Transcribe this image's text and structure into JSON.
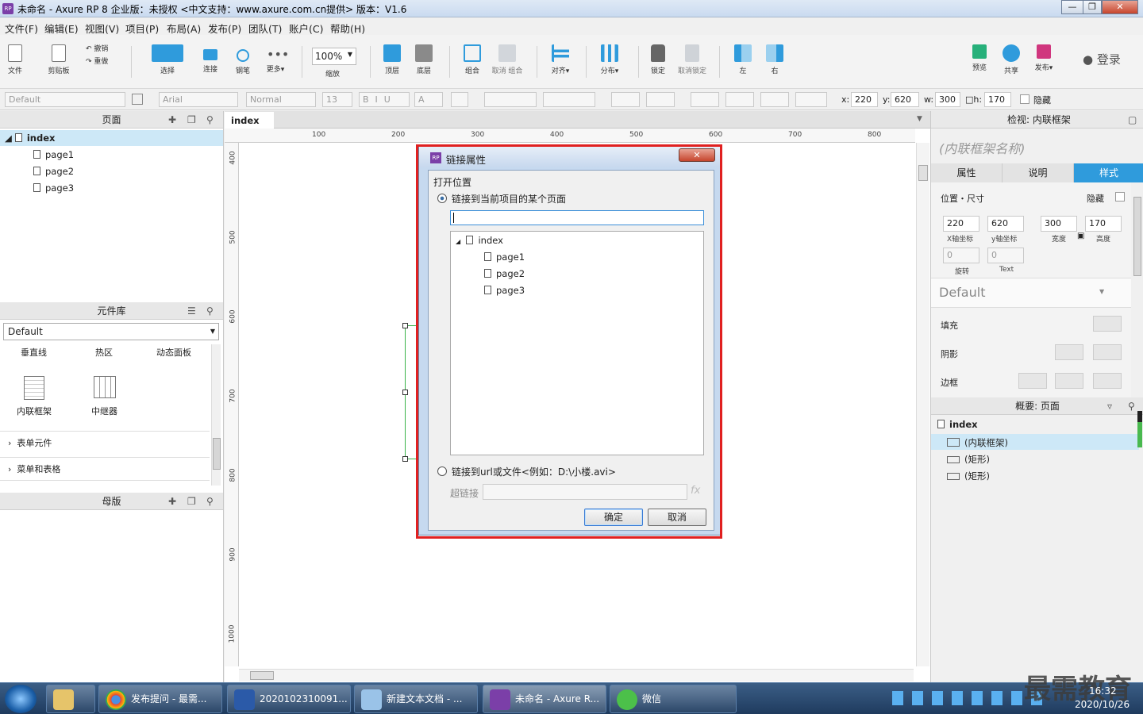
{
  "window": {
    "title": "未命名 - Axure RP 8 企业版：未授权 <中文支持：www.axure.com.cn提供> 版本：V1.6",
    "app_icon": "RP"
  },
  "menu": [
    "文件(F)",
    "编辑(E)",
    "视图(V)",
    "项目(P)",
    "布局(A)",
    "发布(P)",
    "团队(T)",
    "账户(C)",
    "帮助(H)"
  ],
  "toolbar": {
    "file": "文件",
    "clipboard": "剪贴板",
    "undo": "撤销",
    "redo": "重做",
    "select": "选择",
    "connect": "连接",
    "pen": "钢笔",
    "more": "更多▾",
    "zoom_value": "100%",
    "zoom_label": "缩放",
    "top": "顶层",
    "bottom": "底层",
    "group": "组合",
    "ungroup": "取消 组合",
    "align": "对齐▾",
    "distribute": "分布▾",
    "lock": "锁定",
    "unlock": "取消锁定",
    "left": "左",
    "right": "右",
    "preview": "预览",
    "share": "共享",
    "publish": "发布▾",
    "login": "登录"
  },
  "format": {
    "style": "Default",
    "font": "Arial",
    "weight": "Normal",
    "size": "13",
    "x_label": "x:",
    "x": "220",
    "y_label": "y:",
    "y": "620",
    "w_label": "w:",
    "w": "300",
    "h_label": "h:",
    "h": "170",
    "hidden": "隐藏"
  },
  "pages_panel": {
    "title": "页面",
    "root": "index",
    "children": [
      "page1",
      "page2",
      "page3"
    ]
  },
  "library_panel": {
    "title": "元件库",
    "selected": "Default",
    "top_items": [
      "垂直线",
      "热区",
      "动态面板"
    ],
    "items": [
      "内联框架",
      "中继器"
    ],
    "sections": [
      "表单元件",
      "菜单和表格"
    ]
  },
  "masters_panel": {
    "title": "母版"
  },
  "canvas": {
    "tab": "index",
    "ruler_h": [
      "100",
      "200",
      "300",
      "400",
      "500",
      "600",
      "700",
      "800"
    ],
    "ruler_v": [
      "400",
      "500",
      "600",
      "700",
      "800",
      "900",
      "1000"
    ]
  },
  "inspector": {
    "title": "检视: 内联框架",
    "name_placeholder": "(内联框架名称)",
    "tabs": [
      "属性",
      "说明",
      "样式"
    ],
    "active_tab": "样式",
    "pos_size": "位置・尺寸",
    "hidden": "隐藏",
    "x": "220",
    "y": "620",
    "w": "300",
    "h": "170",
    "x_label": "X轴坐标",
    "y_label": "y轴坐标",
    "w_label": "宽度",
    "h_label": "高度",
    "rot": "0",
    "rot_label": "旋转",
    "text_rot": "0",
    "text_label": "Text",
    "style": "Default",
    "fill": "填充",
    "shadow": "阴影",
    "border": "边框"
  },
  "outline": {
    "title": "概要: 页面",
    "root": "index",
    "items": [
      "(内联框架)",
      "(矩形)",
      "(矩形)"
    ]
  },
  "dialog": {
    "title": "链接属性",
    "section": "打开位置",
    "opt1": "链接到当前项目的某个页面",
    "search_value": "",
    "tree_root": "index",
    "tree_children": [
      "page1",
      "page2",
      "page3"
    ],
    "opt2": "链接到url或文件<例如：D:\\小楼.avi>",
    "hyperlink_label": "超链接",
    "fx": "fx",
    "ok": "确定",
    "cancel": "取消"
  },
  "taskbar": {
    "tasks": [
      "发布提问 - 最需...",
      "2020102310091...",
      "新建文本文档 - ...",
      "未命名 - Axure R...",
      "微信"
    ],
    "time": "16:32",
    "date": "2020/10/26",
    "watermark": "最需教育"
  },
  "colors": {
    "accent": "#2f9bdc",
    "selected": "#cde8f7",
    "red": "#e02020"
  }
}
